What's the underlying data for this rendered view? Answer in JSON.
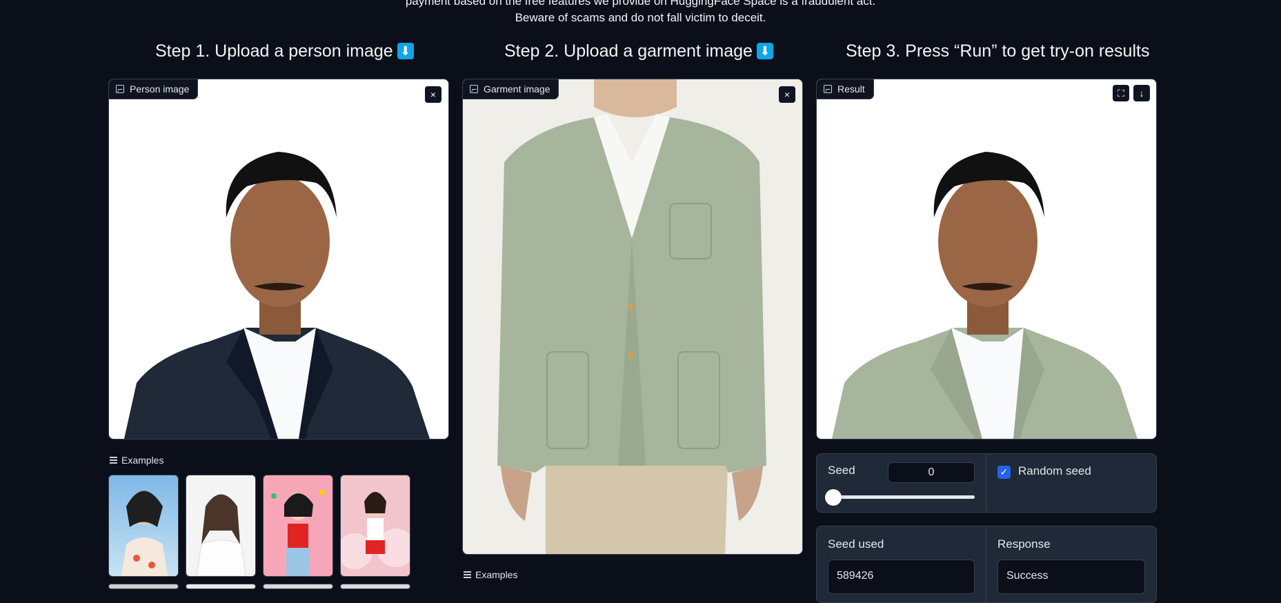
{
  "notice": {
    "line1": "payment based on the free features we provide on HuggingFace Space is a fraudulent act.",
    "line2": "Beware of scams and do not fall victim to deceit."
  },
  "steps": {
    "step1": "Step 1. Upload a person image",
    "step2": "Step 2. Upload a garment image",
    "step3": "Step 3. Press “Run” to get try-on results",
    "arrow_emoji": "⬇"
  },
  "panels": {
    "person_label": "Person image",
    "garment_label": "Garment image",
    "result_label": "Result",
    "examples_label": "Examples"
  },
  "controls": {
    "seed_label": "Seed",
    "seed_value": "0",
    "seed_slider_fraction": 0,
    "random_seed_label": "Random seed",
    "random_seed_checked": true,
    "seed_used_label": "Seed used",
    "seed_used_value": "589426",
    "response_label": "Response",
    "response_value": "Success"
  },
  "icons": {
    "close": "×",
    "fullscreen": "⛶",
    "download": "↓",
    "check": "✓"
  },
  "colors": {
    "background": "#0b0f19",
    "accent": "#2563eb",
    "garment": "#a7b59c"
  }
}
